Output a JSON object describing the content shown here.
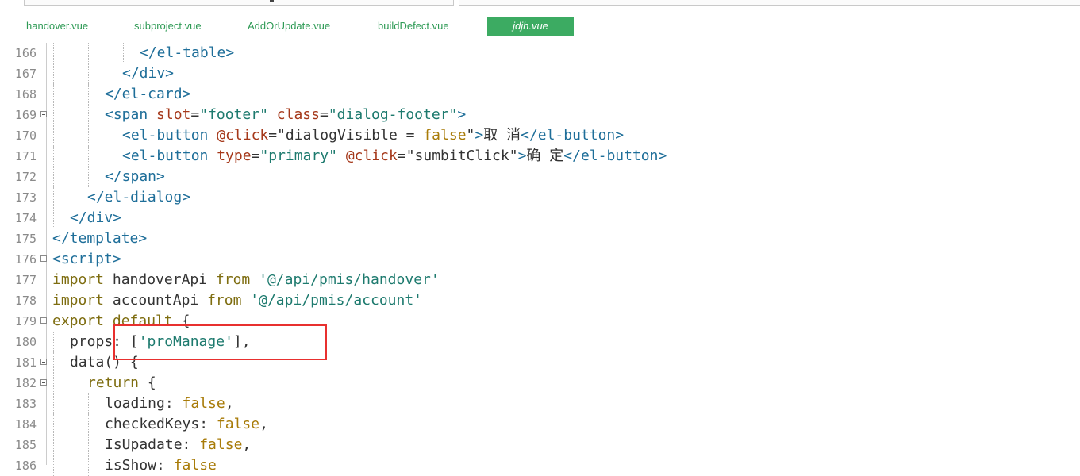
{
  "tabs": [
    {
      "label": "handover.vue"
    },
    {
      "label": "subproject.vue"
    },
    {
      "label": "AddOrUpdate.vue"
    },
    {
      "label": "buildDefect.vue"
    },
    {
      "label": "jdjh.vue",
      "active": true
    }
  ],
  "lines": [
    {
      "num": "166",
      "tokens": [
        {
          "t": "</el-table>",
          "c": "tag"
        }
      ]
    },
    {
      "num": "167",
      "tokens": [
        {
          "t": "</div>",
          "c": "tag"
        }
      ]
    },
    {
      "num": "168",
      "tokens": [
        {
          "t": "</el-card>",
          "c": "tag"
        }
      ]
    },
    {
      "num": "169",
      "fold": true,
      "tokens": [
        {
          "t": "<span ",
          "c": "tag"
        },
        {
          "t": "slot",
          "c": "attr"
        },
        {
          "t": "=",
          "c": "op"
        },
        {
          "t": "\"footer\"",
          "c": "str"
        },
        {
          "t": " ",
          "c": "txt"
        },
        {
          "t": "class",
          "c": "attr"
        },
        {
          "t": "=",
          "c": "op"
        },
        {
          "t": "\"dialog-footer\"",
          "c": "str"
        },
        {
          "t": ">",
          "c": "tag"
        }
      ]
    },
    {
      "num": "170",
      "tokens": [
        {
          "t": "<el-button ",
          "c": "tag"
        },
        {
          "t": "@click",
          "c": "attr"
        },
        {
          "t": "=",
          "c": "op"
        },
        {
          "t": "\"dialogVisible ",
          "c": "txt"
        },
        {
          "t": "=",
          "c": "op"
        },
        {
          "t": " ",
          "c": "txt"
        },
        {
          "t": "false",
          "c": "fls"
        },
        {
          "t": "\"",
          "c": "txt"
        },
        {
          "t": ">",
          "c": "tag"
        },
        {
          "t": "取 消",
          "c": "txt"
        },
        {
          "t": "</el-button>",
          "c": "tag"
        }
      ]
    },
    {
      "num": "171",
      "tokens": [
        {
          "t": "<el-button ",
          "c": "tag"
        },
        {
          "t": "type",
          "c": "attr"
        },
        {
          "t": "=",
          "c": "op"
        },
        {
          "t": "\"primary\"",
          "c": "str"
        },
        {
          "t": " ",
          "c": "txt"
        },
        {
          "t": "@click",
          "c": "attr"
        },
        {
          "t": "=",
          "c": "op"
        },
        {
          "t": "\"sumbitClick\"",
          "c": "txt"
        },
        {
          "t": ">",
          "c": "tag"
        },
        {
          "t": "确 定",
          "c": "txt"
        },
        {
          "t": "</el-button>",
          "c": "tag"
        }
      ]
    },
    {
      "num": "172",
      "tokens": [
        {
          "t": "</span>",
          "c": "tag"
        }
      ]
    },
    {
      "num": "173",
      "tokens": [
        {
          "t": "</el-dialog>",
          "c": "tag"
        }
      ]
    },
    {
      "num": "174",
      "tokens": [
        {
          "t": "</div>",
          "c": "tag"
        }
      ]
    },
    {
      "num": "175",
      "tokens": [
        {
          "t": "</template>",
          "c": "tag"
        }
      ]
    },
    {
      "num": "176",
      "fold": true,
      "tokens": [
        {
          "t": "<script>",
          "c": "tag"
        }
      ]
    },
    {
      "num": "177",
      "tokens": [
        {
          "t": "import",
          "c": "kw"
        },
        {
          "t": " handoverApi ",
          "c": "txt"
        },
        {
          "t": "from",
          "c": "kw"
        },
        {
          "t": " ",
          "c": "txt"
        },
        {
          "t": "'@/api/pmis/handover'",
          "c": "str"
        }
      ]
    },
    {
      "num": "178",
      "tokens": [
        {
          "t": "import",
          "c": "kw"
        },
        {
          "t": " accountApi ",
          "c": "txt"
        },
        {
          "t": "from",
          "c": "kw"
        },
        {
          "t": " ",
          "c": "txt"
        },
        {
          "t": "'@/api/pmis/account'",
          "c": "str"
        }
      ]
    },
    {
      "num": "179",
      "fold": true,
      "tokens": [
        {
          "t": "export",
          "c": "kw"
        },
        {
          "t": " ",
          "c": "txt"
        },
        {
          "t": "default",
          "c": "kw"
        },
        {
          "t": " {",
          "c": "txt"
        }
      ]
    },
    {
      "num": "180",
      "tokens": [
        {
          "t": "props: [",
          "c": "txt"
        },
        {
          "t": "'proManage'",
          "c": "str"
        },
        {
          "t": "],",
          "c": "txt"
        }
      ]
    },
    {
      "num": "181",
      "fold": true,
      "tokens": [
        {
          "t": "data() {",
          "c": "txt"
        }
      ]
    },
    {
      "num": "182",
      "fold": true,
      "tokens": [
        {
          "t": "return",
          "c": "kw"
        },
        {
          "t": " {",
          "c": "txt"
        }
      ]
    },
    {
      "num": "183",
      "tokens": [
        {
          "t": "loading: ",
          "c": "txt"
        },
        {
          "t": "false",
          "c": "fls"
        },
        {
          "t": ",",
          "c": "txt"
        }
      ]
    },
    {
      "num": "184",
      "tokens": [
        {
          "t": "checkedKeys: ",
          "c": "txt"
        },
        {
          "t": "false",
          "c": "fls"
        },
        {
          "t": ",",
          "c": "txt"
        }
      ]
    },
    {
      "num": "185",
      "tokens": [
        {
          "t": "IsUpadate: ",
          "c": "txt"
        },
        {
          "t": "false",
          "c": "fls"
        },
        {
          "t": ",",
          "c": "txt"
        }
      ]
    },
    {
      "num": "186",
      "tokens": [
        {
          "t": "isShow: ",
          "c": "txt"
        },
        {
          "t": "false",
          "c": "fls"
        }
      ]
    }
  ],
  "colors": {
    "accent": "#3cab62",
    "tag": "#1e6e99",
    "attr": "#a5381a",
    "string": "#1d7a6e",
    "keyword": "#7e6d10",
    "highlight": "#e8302f"
  }
}
